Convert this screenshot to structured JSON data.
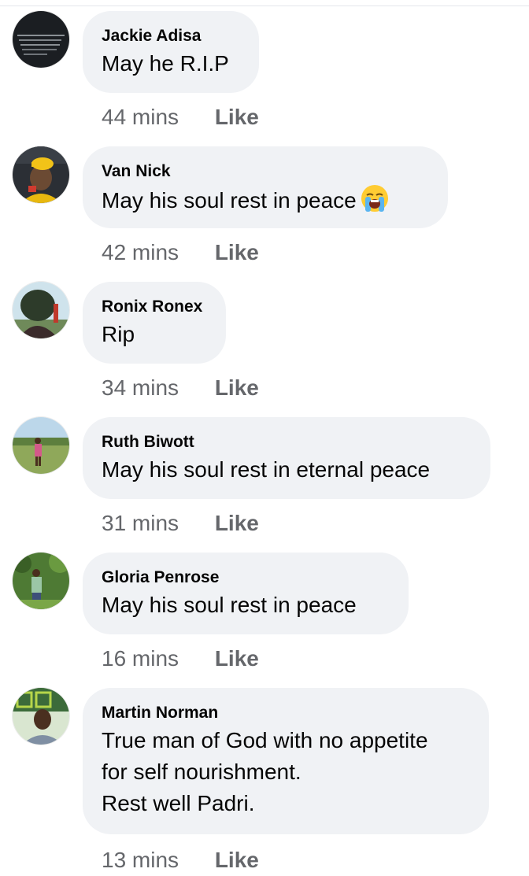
{
  "comments": [
    {
      "author": "Jackie Adisa",
      "text": "May he R.I.P",
      "time": "44 mins",
      "like": "Like",
      "avatar_icon": "dark-quote-text-avatar"
    },
    {
      "author": "Van Nick",
      "text": "May his soul rest in peace",
      "emoji": "loudly-crying-face-emoji",
      "time": "42 mins",
      "like": "Like",
      "avatar_icon": "yellow-hat-person-avatar"
    },
    {
      "author": "Ronix Ronex",
      "text": "Rip",
      "time": "34 mins",
      "like": "Like",
      "avatar_icon": "sky-person-avatar"
    },
    {
      "author": "Ruth Biwott",
      "text": "May his soul rest in eternal peace",
      "time": "31 mins",
      "like": "Like",
      "avatar_icon": "field-person-avatar"
    },
    {
      "author": "Gloria Penrose",
      "text": "May his soul rest in peace",
      "time": "16 mins",
      "like": "Like",
      "avatar_icon": "garden-person-avatar"
    },
    {
      "author": "Martin Norman",
      "text_lines": [
        "True man of God with no appetite",
        "for self nourishment.",
        "Rest well Padri."
      ],
      "time": "13 mins",
      "like": "Like",
      "avatar_icon": "sign-background-person-avatar"
    }
  ],
  "colors": {
    "bubble_bg": "#f0f2f5",
    "meta_text": "#65676b",
    "primary_text": "#050505",
    "divider": "#e4e6eb"
  }
}
